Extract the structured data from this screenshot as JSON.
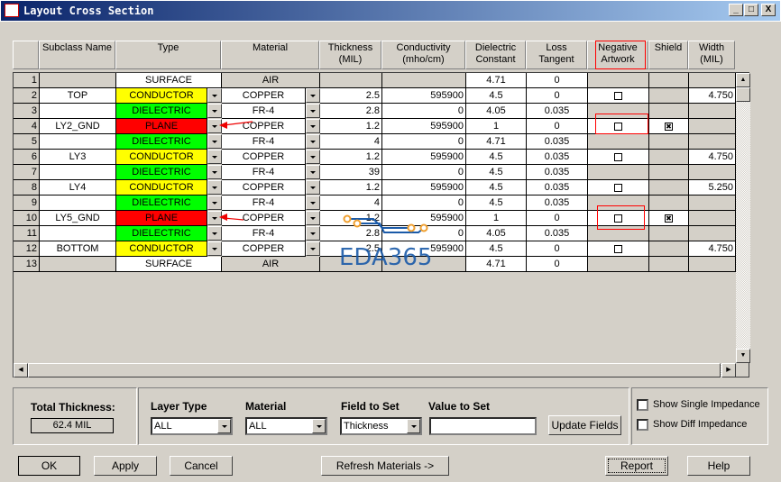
{
  "window": {
    "title": "Layout Cross Section",
    "minimize": "_",
    "maximize": "□",
    "close": "X"
  },
  "columns": [
    "",
    "Subclass Name",
    "Type",
    "Material",
    "Thickness\n(MIL)",
    "Conductivity\n(mho/cm)",
    "Dielectric\nConstant",
    "Loss\nTangent",
    "Negative\nArtwork",
    "Shield",
    "Width\n(MIL)"
  ],
  "rows": [
    {
      "n": "1",
      "sub": "",
      "type": "SURFACE",
      "mat": "AIR",
      "th": "",
      "cond": "",
      "dc": "4.71",
      "lt": "0",
      "neg": null,
      "shield": null,
      "w": ""
    },
    {
      "n": "2",
      "sub": "TOP",
      "type": "CONDUCTOR",
      "mat": "COPPER",
      "th": "2.5",
      "cond": "595900",
      "dc": "4.5",
      "lt": "0",
      "neg": false,
      "shield": null,
      "w": "4.750"
    },
    {
      "n": "3",
      "sub": "",
      "type": "DIELECTRIC",
      "mat": "FR-4",
      "th": "2.8",
      "cond": "0",
      "dc": "4.05",
      "lt": "0.035",
      "neg": null,
      "shield": null,
      "w": ""
    },
    {
      "n": "4",
      "sub": "LY2_GND",
      "type": "PLANE",
      "mat": "COPPER",
      "th": "1.2",
      "cond": "595900",
      "dc": "1",
      "lt": "0",
      "neg": false,
      "shield": true,
      "w": ""
    },
    {
      "n": "5",
      "sub": "",
      "type": "DIELECTRIC",
      "mat": "FR-4",
      "th": "4",
      "cond": "0",
      "dc": "4.71",
      "lt": "0.035",
      "neg": null,
      "shield": null,
      "w": ""
    },
    {
      "n": "6",
      "sub": "LY3",
      "type": "CONDUCTOR",
      "mat": "COPPER",
      "th": "1.2",
      "cond": "595900",
      "dc": "4.5",
      "lt": "0.035",
      "neg": false,
      "shield": null,
      "w": "4.750"
    },
    {
      "n": "7",
      "sub": "",
      "type": "DIELECTRIC",
      "mat": "FR-4",
      "th": "39",
      "cond": "0",
      "dc": "4.5",
      "lt": "0.035",
      "neg": null,
      "shield": null,
      "w": ""
    },
    {
      "n": "8",
      "sub": "LY4",
      "type": "CONDUCTOR",
      "mat": "COPPER",
      "th": "1.2",
      "cond": "595900",
      "dc": "4.5",
      "lt": "0.035",
      "neg": false,
      "shield": null,
      "w": "5.250"
    },
    {
      "n": "9",
      "sub": "",
      "type": "DIELECTRIC",
      "mat": "FR-4",
      "th": "4",
      "cond": "0",
      "dc": "4.5",
      "lt": "0.035",
      "neg": null,
      "shield": null,
      "w": ""
    },
    {
      "n": "10",
      "sub": "LY5_GND",
      "type": "PLANE",
      "mat": "COPPER",
      "th": "1.2",
      "cond": "595900",
      "dc": "1",
      "lt": "0",
      "neg": false,
      "shield": true,
      "w": ""
    },
    {
      "n": "11",
      "sub": "",
      "type": "DIELECTRIC",
      "mat": "FR-4",
      "th": "2.8",
      "cond": "0",
      "dc": "4.05",
      "lt": "0.035",
      "neg": null,
      "shield": null,
      "w": ""
    },
    {
      "n": "12",
      "sub": "BOTTOM",
      "type": "CONDUCTOR",
      "mat": "COPPER",
      "th": "2.5",
      "cond": "595900",
      "dc": "4.5",
      "lt": "0",
      "neg": false,
      "shield": null,
      "w": "4.750"
    },
    {
      "n": "13",
      "sub": "",
      "type": "SURFACE",
      "mat": "AIR",
      "th": "",
      "cond": "",
      "dc": "4.71",
      "lt": "0",
      "neg": null,
      "shield": null,
      "w": ""
    }
  ],
  "type_colors": {
    "CONDUCTOR": "#ffff00",
    "DIELECTRIC": "#00ff00",
    "PLANE": "#ff0000",
    "SURFACE": "#ffffff"
  },
  "watermark": "EDA365",
  "bottom": {
    "total_label": "Total Thickness:",
    "total_value": "62.4 MIL",
    "layer_type_label": "Layer Type",
    "layer_type_value": "ALL",
    "material_label": "Material",
    "material_value": "ALL",
    "field_label": "Field to Set",
    "field_value": "Thickness",
    "value_label": "Value to Set",
    "value_value": "",
    "update": "Update Fields",
    "single_imp": "Show Single Impedance",
    "diff_imp": "Show Diff Impedance"
  },
  "buttons": {
    "ok": "OK",
    "apply": "Apply",
    "cancel": "Cancel",
    "refresh": "Refresh Materials ->",
    "report": "Report",
    "help": "Help"
  }
}
